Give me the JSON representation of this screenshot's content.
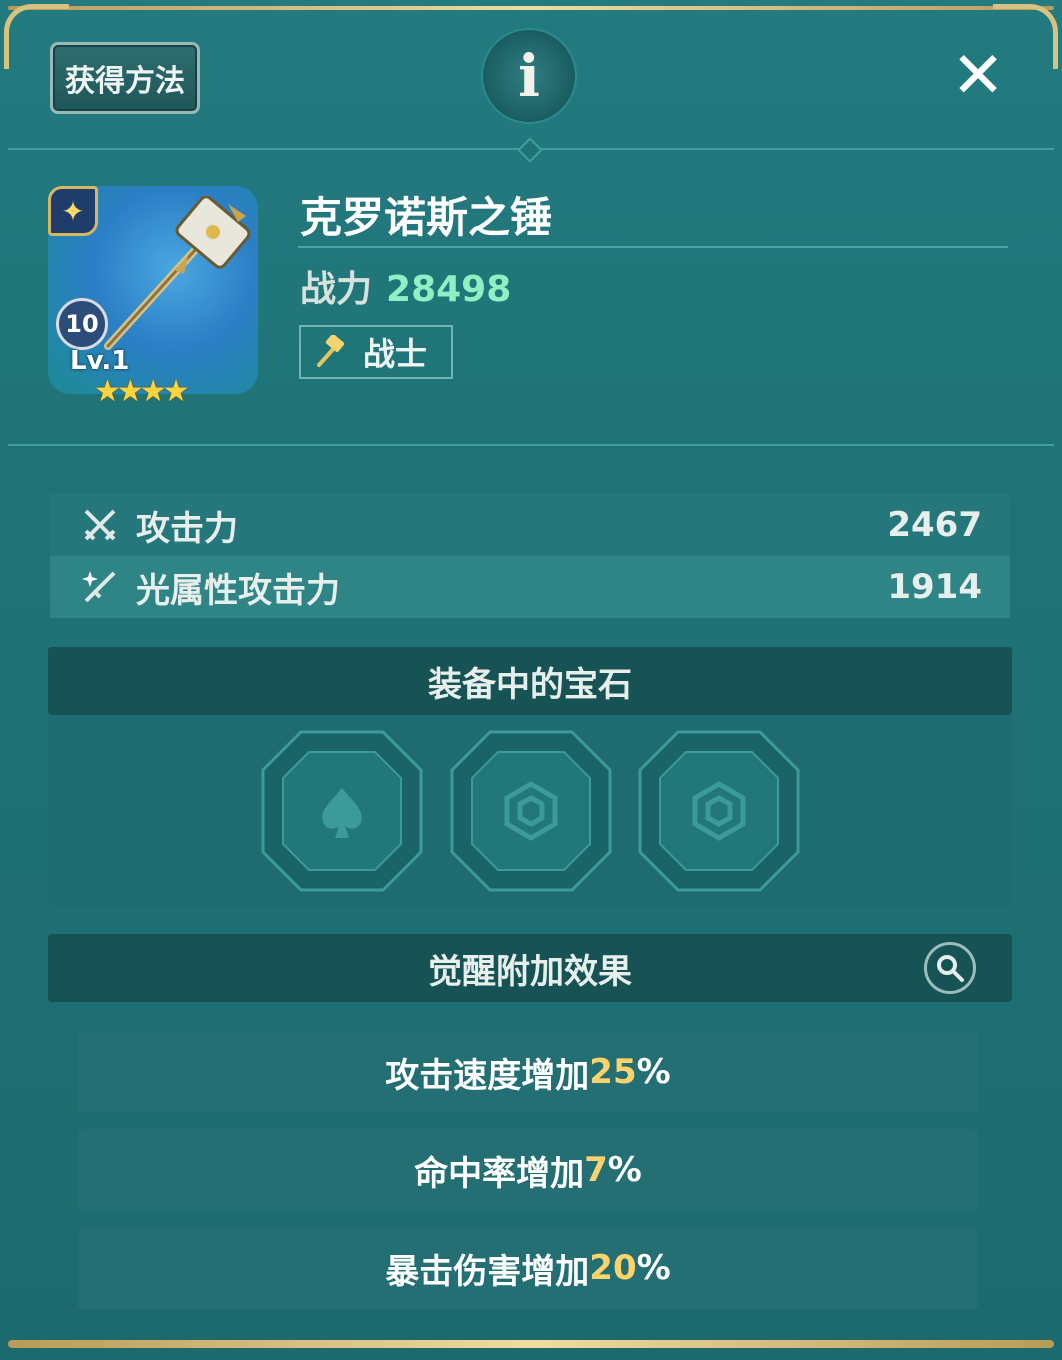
{
  "header": {
    "acquire_label": "获得方法",
    "info_icon": "i",
    "close_icon": "✕"
  },
  "item": {
    "name": "克罗诺斯之锤",
    "power_label": "战力",
    "power_value": "28498",
    "class_label": "战士",
    "level_badge": "10",
    "level_text": "Lv.1",
    "stars": "★★★★",
    "star_count": 4,
    "badge_icon": "✦"
  },
  "stats": [
    {
      "label": "攻击力",
      "value": "2467",
      "icon": "crossed-swords-icon"
    },
    {
      "label": "光属性攻击力",
      "value": "1914",
      "icon": "light-sword-icon"
    }
  ],
  "gems": {
    "title": "装备中的宝石",
    "slots": [
      {
        "icon": "spade-gem-icon"
      },
      {
        "icon": "hexagon-gem-icon"
      },
      {
        "icon": "hexagon-gem-icon"
      }
    ]
  },
  "awakening": {
    "title": "觉醒附加效果",
    "effects": [
      {
        "text": "攻击速度增加",
        "value": "25",
        "suffix": "%"
      },
      {
        "text": "命中率增加",
        "value": "7",
        "suffix": "%"
      },
      {
        "text": "暴击伤害增加",
        "value": "20",
        "suffix": "%"
      }
    ]
  },
  "colors": {
    "panel_bg": "#1f7276",
    "gold": "#d9c17e",
    "power_green": "#8ff0c3",
    "effect_yellow": "#ffd36b"
  }
}
